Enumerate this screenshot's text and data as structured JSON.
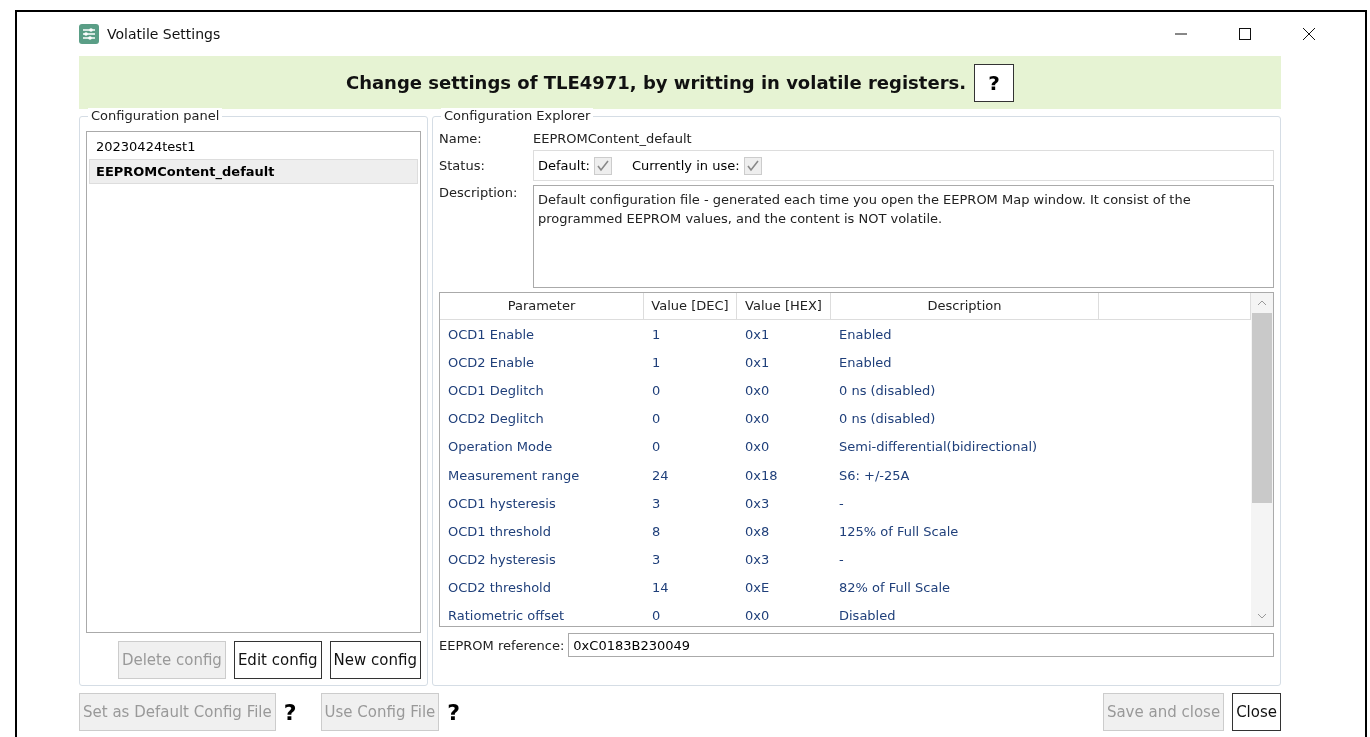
{
  "window": {
    "title": "Volatile Settings"
  },
  "banner": {
    "text": "Change settings of TLE4971, by writting in volatile registers.",
    "help": "?"
  },
  "configuration_panel": {
    "title": "Configuration panel",
    "items": [
      {
        "label": "20230424test1",
        "selected": false
      },
      {
        "label": "EEPROMContent_default",
        "selected": true
      }
    ],
    "buttons": [
      {
        "label": "Delete config",
        "disabled": true
      },
      {
        "label": "Edit config",
        "disabled": false
      },
      {
        "label": "New config",
        "disabled": false
      }
    ]
  },
  "configuration_explorer": {
    "title": "Configuration Explorer",
    "name_label": "Name:",
    "name": "EEPROMContent_default",
    "status_label": "Status:",
    "status": [
      {
        "label": "Default:",
        "checked": true
      },
      {
        "label": "Currently in use:",
        "checked": true
      }
    ],
    "description_label": "Description:",
    "description": "Default configuration file - generated each time you open the EEPROM Map window. It consist of the programmed EEPROM values, and the content is NOT volatile.",
    "table": {
      "columns": [
        "Parameter",
        "Value [DEC]",
        "Value [HEX]",
        "Description"
      ],
      "rows": [
        [
          "OCD1 Enable",
          "1",
          "0x1",
          "Enabled"
        ],
        [
          "OCD2 Enable",
          "1",
          "0x1",
          "Enabled"
        ],
        [
          "OCD1 Deglitch",
          "0",
          "0x0",
          "0 ns (disabled)"
        ],
        [
          "OCD2 Deglitch",
          "0",
          "0x0",
          "0 ns (disabled)"
        ],
        [
          "Operation Mode",
          "0",
          "0x0",
          "Semi-differential(bidirectional)"
        ],
        [
          "Measurement range",
          "24",
          "0x18",
          "S6: +/-25A"
        ],
        [
          "OCD1 hysteresis",
          "3",
          "0x3",
          "-"
        ],
        [
          "OCD1 threshold",
          "8",
          "0x8",
          "125% of Full Scale"
        ],
        [
          "OCD2 hysteresis",
          "3",
          "0x3",
          "-"
        ],
        [
          "OCD2 threshold",
          "14",
          "0xE",
          "82% of Full Scale"
        ],
        [
          "Ratiometric offset",
          "0",
          "0x0",
          "Disabled"
        ]
      ]
    },
    "reference_label": "EEPROM reference:",
    "reference": "0xC0183B230049"
  },
  "footer": {
    "left": [
      {
        "label": "Set as Default Config File",
        "disabled": true,
        "help": "?"
      },
      {
        "label": "Use Config File",
        "disabled": true,
        "help": "?"
      }
    ],
    "right": [
      {
        "label": "Save and close",
        "disabled": true
      },
      {
        "label": "Close",
        "disabled": false
      }
    ]
  }
}
